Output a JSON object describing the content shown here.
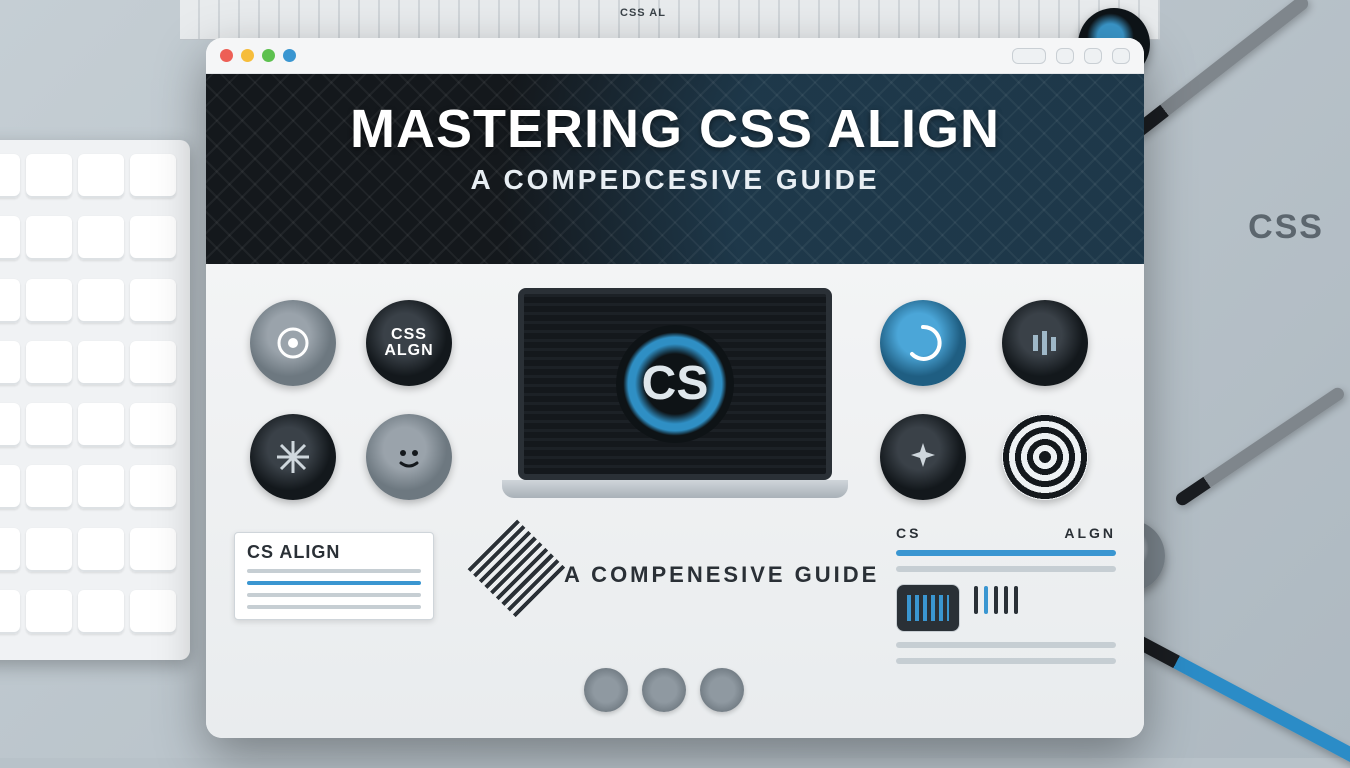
{
  "desk": {
    "ruler_label": "CSS AL",
    "side_text": "CSS"
  },
  "window": {
    "hero_title": "MASTERING CSS ALIGN",
    "hero_subtitle": "A COMPEDCESIVE GUIDE",
    "laptop_logo_letter": "CS",
    "badges": {
      "css_align": "CSS\nALGN"
    },
    "cards": {
      "left_card_title": "CS ALIGN",
      "mid_card_title": ""
    },
    "bottom_subtitle": "A COMPENESIVE GUIDE",
    "side_panel": {
      "left_label": "CS",
      "right_label": "ALGN"
    }
  }
}
